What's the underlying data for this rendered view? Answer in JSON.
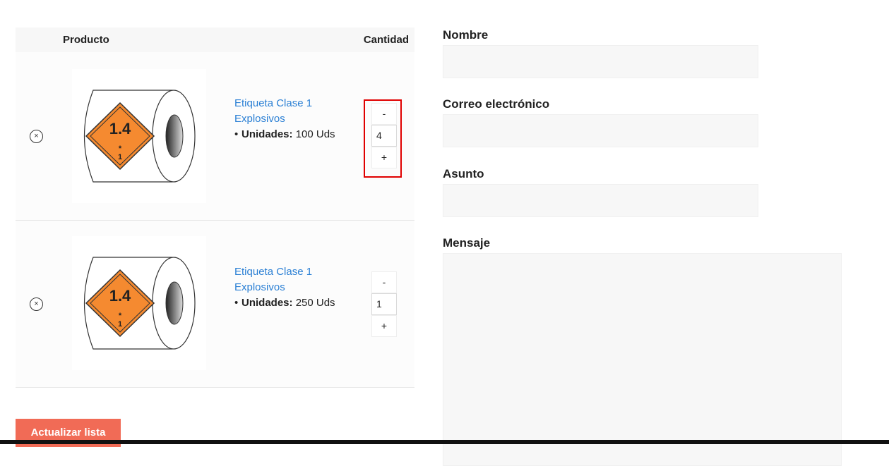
{
  "cart": {
    "header": {
      "product": "Producto",
      "quantity": "Cantidad"
    },
    "items": [
      {
        "remove_icon": "×",
        "title": "Etiqueta Clase 1 Explosivos",
        "attr_label": "Unidades:",
        "attr_value": "100 Uds",
        "qty_minus": "-",
        "qty_value": "4",
        "qty_plus": "+",
        "image_text": "1.4",
        "image_sub": "*\n1"
      },
      {
        "remove_icon": "×",
        "title": "Etiqueta Clase 1 Explosivos",
        "attr_label": "Unidades:",
        "attr_value": "250 Uds",
        "qty_minus": "-",
        "qty_value": "1",
        "qty_plus": "+",
        "image_text": "1.4",
        "image_sub": "*\n1"
      }
    ],
    "update_button": "Actualizar lista"
  },
  "form": {
    "name_label": "Nombre",
    "email_label": "Correo electrónico",
    "subject_label": "Asunto",
    "message_label": "Mensaje"
  },
  "colors": {
    "link": "#2a7fd4",
    "button": "#f16b56",
    "label_orange": "#f58a30",
    "highlight": "#e00000"
  }
}
